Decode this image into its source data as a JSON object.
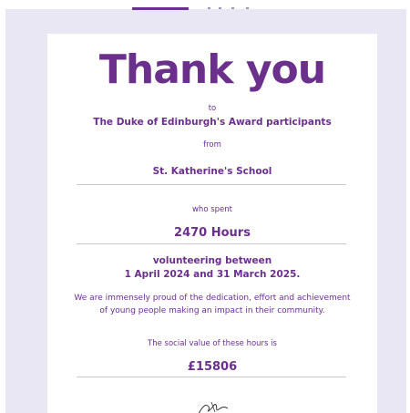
{
  "certificate": {
    "headline": "Thank you",
    "to_label": "to",
    "recipient": "The Duke of Edinburgh's Award participants",
    "from_label": "from",
    "sender": "St. Katherine's School",
    "spent_label": "who spent",
    "hours": "2470 Hours",
    "volunteering_line1": "volunteering between",
    "volunteering_line2": "1 April 2024 and 31 March 2025.",
    "message_line1": "We are immensely proud of the dedication, effort and achievement",
    "message_line2": "of young people making an impact in their community.",
    "value_label": "The social value of these hours is",
    "value_amount": "£15806"
  },
  "colors": {
    "accent": "#6b2f8c",
    "page_background": "#e9e7f3",
    "card_background": "#ffffff",
    "divider": "#c9c9c9"
  }
}
